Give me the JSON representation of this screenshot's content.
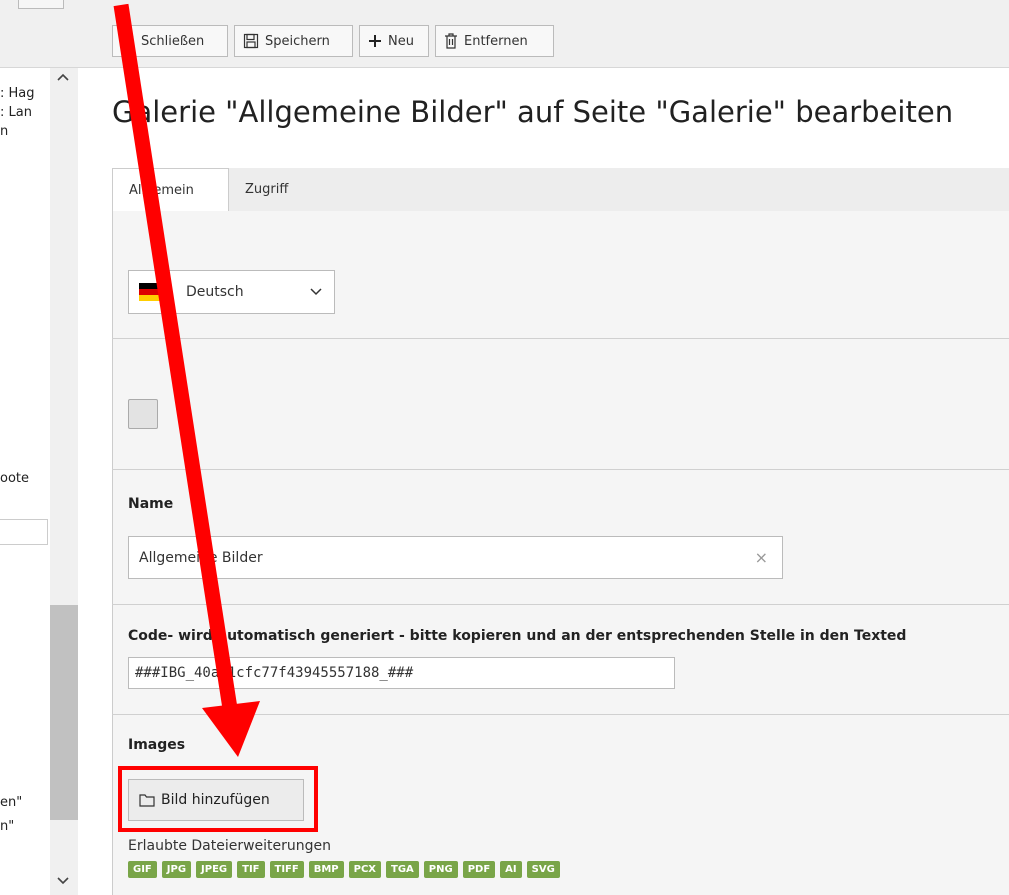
{
  "toolbar": {
    "close_label": "Schließen",
    "save_label": "Speichern",
    "new_label": "Neu",
    "delete_label": "Entfernen"
  },
  "tree": {
    "items": [
      ": Hag",
      ": Lan",
      "n",
      "oote",
      "en\"",
      "n\""
    ]
  },
  "page_title": "Galerie \"Allgemeine Bilder\" auf Seite \"Galerie\" bearbeiten",
  "tabs": [
    {
      "label": "Allgemein",
      "active": true
    },
    {
      "label": "Zugriff",
      "active": false
    }
  ],
  "language": {
    "selected": "Deutsch",
    "flag_colors": [
      "#000000",
      "#dd0000",
      "#ffce00"
    ]
  },
  "fields": {
    "name_label": "Name",
    "name_value": "Allgemeine Bilder",
    "code_label": "Code- wird automatisch generiert - bitte kopieren und an der entsprechenden Stelle in den Texted",
    "code_value": "###IBG_40a21cfc77f43945557188_###",
    "images_label": "Images"
  },
  "images": {
    "add_button_label": "Bild hinzufügen",
    "allowed_label": "Erlaubte Dateierweiterungen",
    "extensions": [
      "GIF",
      "JPG",
      "JPEG",
      "TIF",
      "TIFF",
      "BMP",
      "PCX",
      "TGA",
      "PNG",
      "PDF",
      "AI",
      "SVG"
    ]
  },
  "annotation": {
    "color": "#ff0000"
  }
}
